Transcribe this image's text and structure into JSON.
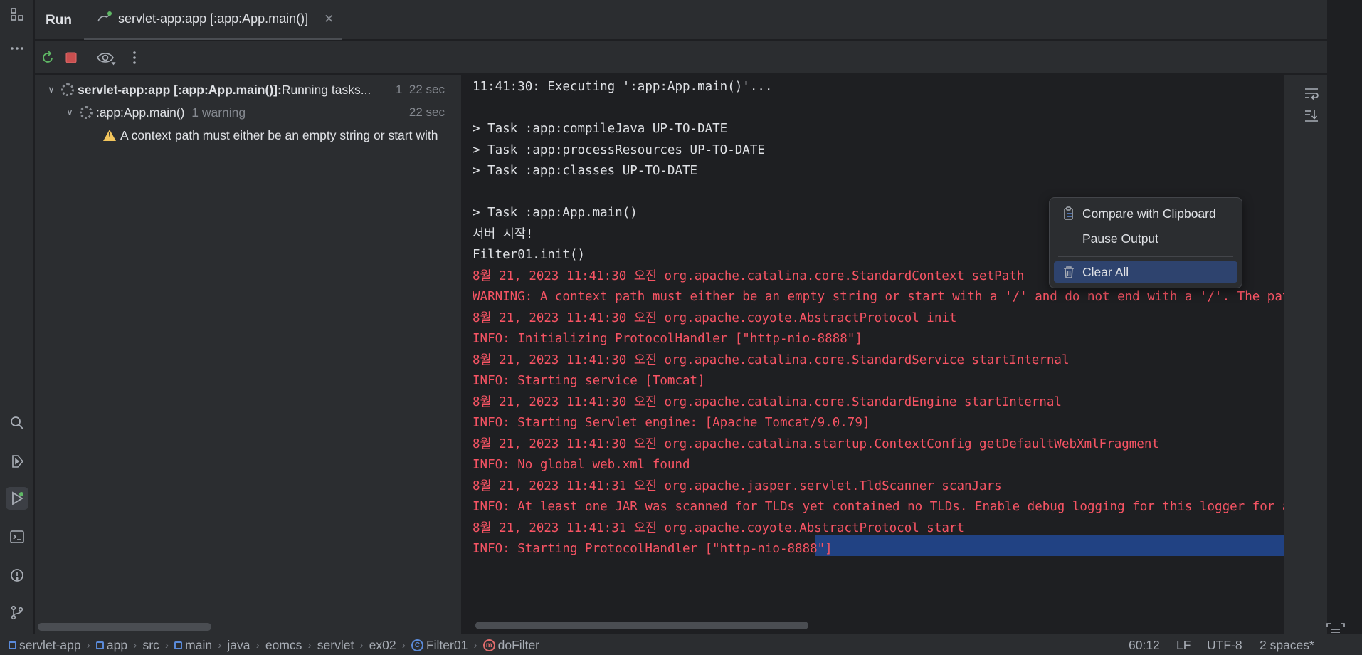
{
  "tabs": {
    "run_label": "Run",
    "run_tab_label": "servlet-app:app [:app:App.main()]"
  },
  "tree": {
    "root": {
      "label_bold": "servlet-app:app [:app:App.main()]:",
      "label_rest": " Running tasks...",
      "count": "1",
      "time": "22 sec"
    },
    "child": {
      "label": ":app:App.main()",
      "warnings": "1 warning",
      "time": "22 sec"
    },
    "warning": {
      "text": "A context path must either be an empty string or start with"
    }
  },
  "console": {
    "lines": [
      {
        "text": "11:41:30: Executing ':app:App.main()'...",
        "color": "white"
      },
      {
        "text": "",
        "color": "white"
      },
      {
        "text": "> Task :app:compileJava UP-TO-DATE",
        "color": "white"
      },
      {
        "text": "> Task :app:processResources UP-TO-DATE",
        "color": "white"
      },
      {
        "text": "> Task :app:classes UP-TO-DATE",
        "color": "white"
      },
      {
        "text": "",
        "color": "white"
      },
      {
        "text": "> Task :app:App.main()",
        "color": "white"
      },
      {
        "text": "서버 시작!",
        "color": "white"
      },
      {
        "text": "Filter01.init()",
        "color": "white"
      },
      {
        "text": "8월 21, 2023 11:41:30 오전 org.apache.catalina.core.StandardContext setPath",
        "color": "red"
      },
      {
        "text": "WARNING: A context path must either be an empty string or start with a '/' and do not end with a '/'. The path [/]",
        "color": "red"
      },
      {
        "text": "8월 21, 2023 11:41:30 오전 org.apache.coyote.AbstractProtocol init",
        "color": "red"
      },
      {
        "text": "INFO: Initializing ProtocolHandler [\"http-nio-8888\"]",
        "color": "red"
      },
      {
        "text": "8월 21, 2023 11:41:30 오전 org.apache.catalina.core.StandardService startInternal",
        "color": "red"
      },
      {
        "text": "INFO: Starting service [Tomcat]",
        "color": "red"
      },
      {
        "text": "8월 21, 2023 11:41:30 오전 org.apache.catalina.core.StandardEngine startInternal",
        "color": "red"
      },
      {
        "text": "INFO: Starting Servlet engine: [Apache Tomcat/9.0.79]",
        "color": "red"
      },
      {
        "text": "8월 21, 2023 11:41:30 오전 org.apache.catalina.startup.ContextConfig getDefaultWebXmlFragment",
        "color": "red"
      },
      {
        "text": "INFO: No global web.xml found",
        "color": "red"
      },
      {
        "text": "8월 21, 2023 11:41:31 오전 org.apache.jasper.servlet.TldScanner scanJars",
        "color": "red"
      },
      {
        "text": "INFO: At least one JAR was scanned for TLDs yet contained no TLDs. Enable debug logging for this logger for a comp",
        "color": "red"
      },
      {
        "text": "8월 21, 2023 11:41:31 오전 org.apache.coyote.AbstractProtocol start",
        "color": "red"
      },
      {
        "text": "INFO: Starting ProtocolHandler [\"http-nio-8888\"]",
        "color": "red"
      }
    ]
  },
  "context_menu": {
    "compare": "Compare with Clipboard",
    "pause": "Pause Output",
    "clear": "Clear All"
  },
  "status_bar": {
    "crumbs": [
      "servlet-app",
      "app",
      "src",
      "main",
      "java",
      "eomcs",
      "servlet",
      "ex02",
      "Filter01",
      "doFilter"
    ],
    "position": "60:12",
    "line_sep": "LF",
    "encoding": "UTF-8",
    "indent": "2 spaces*"
  },
  "colors": {
    "error_text": "#f75464",
    "selection": "#214283",
    "accent": "#3574f0"
  }
}
